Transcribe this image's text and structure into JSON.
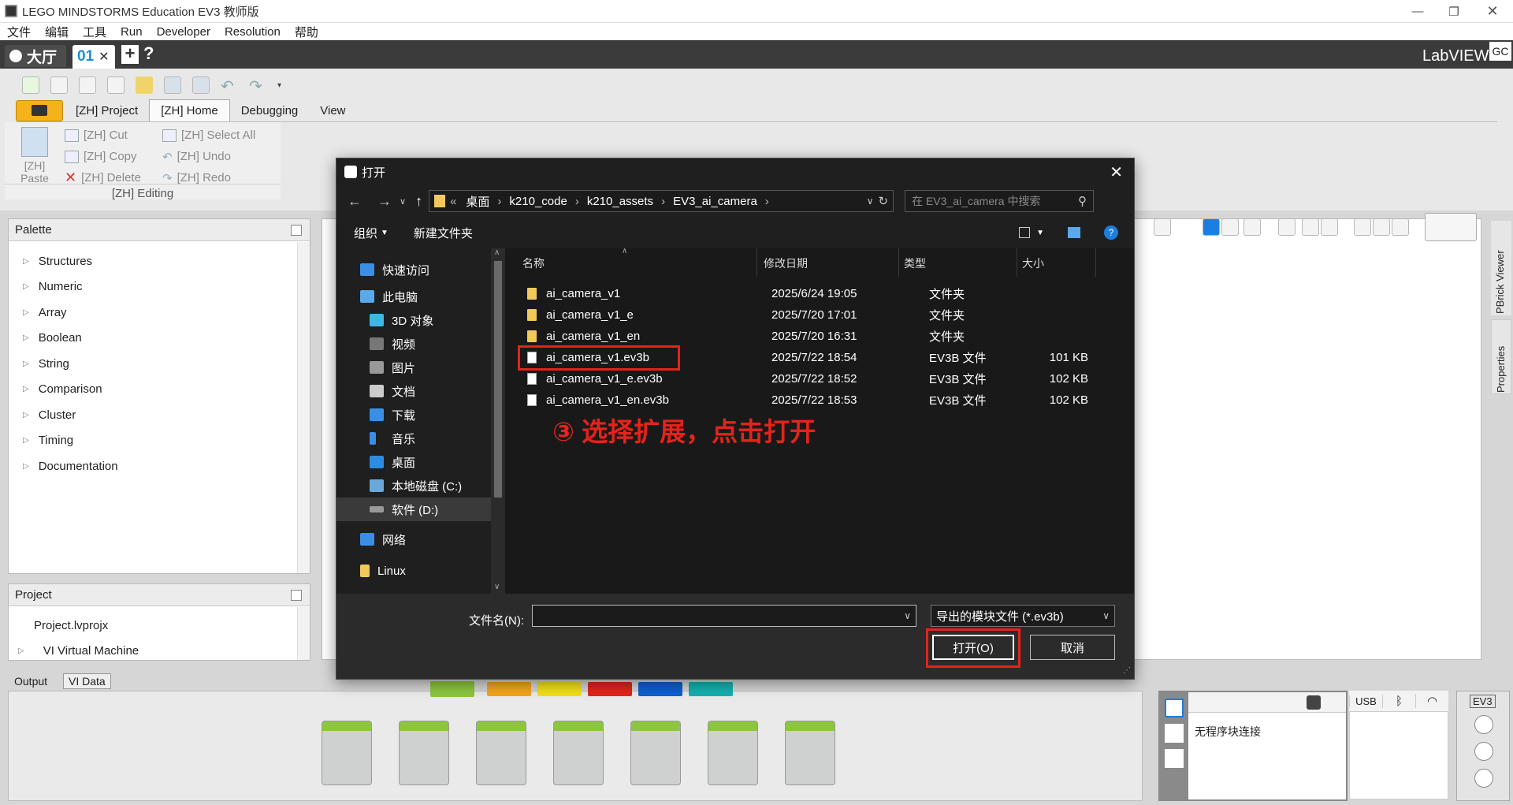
{
  "window": {
    "title": "LEGO MINDSTORMS Education EV3 教师版"
  },
  "menu": [
    "文件",
    "编辑",
    "工具",
    "Run",
    "Developer",
    "Resolution",
    "帮助"
  ],
  "tabs": {
    "lobby": "大厅",
    "program": "01",
    "gc": "GC",
    "labview": "LabVIEW"
  },
  "ribbon": {
    "tabs": [
      "[ZH] Project",
      "[ZH] Home",
      "Debugging",
      "View"
    ],
    "paste": "[ZH]\nPaste",
    "paste_l1": "[ZH]",
    "paste_l2": "Paste",
    "cut": "[ZH] Cut",
    "copy": "[ZH] Copy",
    "delete": "[ZH] Delete",
    "select_all": "[ZH] Select All",
    "undo": "[ZH] Undo",
    "redo": "[ZH] Redo",
    "group": "[ZH] Editing"
  },
  "palette": {
    "title": "Palette",
    "items": [
      "Structures",
      "Numeric",
      "Array",
      "Boolean",
      "String",
      "Comparison",
      "Cluster",
      "Timing",
      "Documentation"
    ]
  },
  "project": {
    "title": "Project",
    "file": "Project.lvprojx",
    "child": "VI Virtual Machine"
  },
  "bottom_tabs": {
    "output": "Output",
    "vidata": "VI Data"
  },
  "side_tabs": {
    "brick_viewer": "PBrick Viewer",
    "properties": "Properties"
  },
  "hw": {
    "usb": "USB",
    "status": "无程序块连接",
    "ev3": "EV3"
  },
  "dialog": {
    "title": "打开",
    "breadcrumb": [
      "桌面",
      "k210_code",
      "k210_assets",
      "EV3_ai_camera"
    ],
    "search_placeholder": "在 EV3_ai_camera 中搜索",
    "organize": "组织",
    "new_folder": "新建文件夹",
    "nav": [
      "快速访问",
      "此电脑",
      "3D 对象",
      "视频",
      "图片",
      "文档",
      "下载",
      "音乐",
      "桌面",
      "本地磁盘 (C:)",
      "软件 (D:)",
      "网络",
      "Linux"
    ],
    "columns": [
      "名称",
      "修改日期",
      "类型",
      "大小"
    ],
    "files": [
      {
        "name": "ai_camera_v1",
        "date": "2025/6/24 19:05",
        "type": "文件夹",
        "size": "",
        "kind": "folder"
      },
      {
        "name": "ai_camera_v1_e",
        "date": "2025/7/20 17:01",
        "type": "文件夹",
        "size": "",
        "kind": "folder"
      },
      {
        "name": "ai_camera_v1_en",
        "date": "2025/7/20 16:31",
        "type": "文件夹",
        "size": "",
        "kind": "folder"
      },
      {
        "name": "ai_camera_v1.ev3b",
        "date": "2025/7/22 18:54",
        "type": "EV3B 文件",
        "size": "101 KB",
        "kind": "file"
      },
      {
        "name": "ai_camera_v1_e.ev3b",
        "date": "2025/7/22 18:52",
        "type": "EV3B 文件",
        "size": "102 KB",
        "kind": "file"
      },
      {
        "name": "ai_camera_v1_en.ev3b",
        "date": "2025/7/22 18:53",
        "type": "EV3B 文件",
        "size": "102 KB",
        "kind": "file"
      }
    ],
    "annotation": "③ 选择扩展，点击打开",
    "filename_label": "文件名(N):",
    "filename_value": "",
    "filetype": "导出的模块文件 (*.ev3b)",
    "open": "打开(O)",
    "cancel": "取消"
  },
  "colors": {
    "annotation": "#e4231b",
    "accent": "#0a84d6",
    "block_top": "#8bc63e"
  },
  "swatches": [
    "#8bc63e",
    "#f4a51c",
    "#f1e01a",
    "#e1251b",
    "#0f5fd0",
    "#15b1b0"
  ]
}
